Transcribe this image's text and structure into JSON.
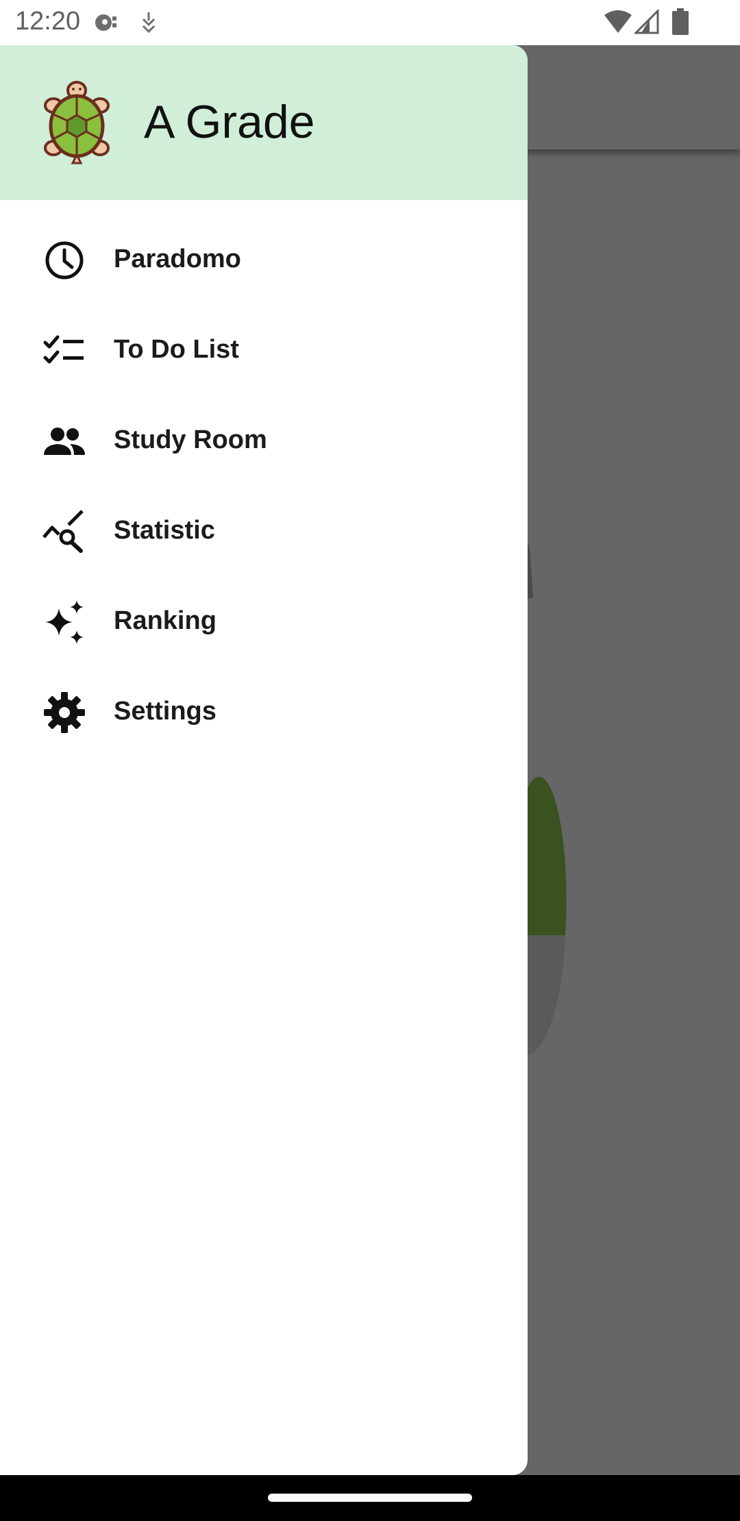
{
  "status_bar": {
    "time": "12:20"
  },
  "drawer": {
    "title": "A Grade",
    "header_color": "#d0eed8",
    "items": [
      {
        "label": "Paradomo",
        "icon": "clock-icon"
      },
      {
        "label": "To Do List",
        "icon": "checklist-icon"
      },
      {
        "label": "Study Room",
        "icon": "people-icon"
      },
      {
        "label": "Statistic",
        "icon": "stats-search-icon"
      },
      {
        "label": "Ranking",
        "icon": "sparkle-icon"
      },
      {
        "label": "Settings",
        "icon": "gear-icon"
      }
    ]
  },
  "colors": {
    "scrim": "#666666",
    "accent_green": "#3a5220"
  }
}
